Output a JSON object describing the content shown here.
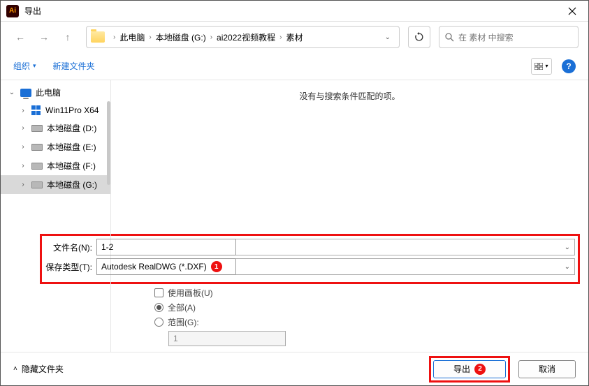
{
  "titlebar": {
    "title": "导出"
  },
  "nav": {
    "breadcrumb": [
      "此电脑",
      "本地磁盘 (G:)",
      "ai2022视频教程",
      "素材"
    ],
    "search_placeholder": "在 素材 中搜索"
  },
  "toolbar": {
    "organize": "组织",
    "new_folder": "新建文件夹"
  },
  "sidebar": {
    "root": "此电脑",
    "items": [
      {
        "label": "Win11Pro X64",
        "icon": "win"
      },
      {
        "label": "本地磁盘 (D:)",
        "icon": "disk"
      },
      {
        "label": "本地磁盘 (E:)",
        "icon": "disk"
      },
      {
        "label": "本地磁盘 (F:)",
        "icon": "disk"
      },
      {
        "label": "本地磁盘 (G:)",
        "icon": "disk",
        "selected": true
      }
    ]
  },
  "main": {
    "empty_text": "没有与搜索条件匹配的项。"
  },
  "form": {
    "filename_label": "文件名(N):",
    "filename_value": "1-2",
    "type_label": "保存类型(T):",
    "type_value": "Autodesk RealDWG (*.DXF)",
    "use_artboard": "使用画板(U)",
    "opt_all": "全部(A)",
    "opt_range": "范围(G):",
    "range_value": "1",
    "badge1": "1"
  },
  "footer": {
    "hide_folders": "隐藏文件夹",
    "export": "导出",
    "cancel": "取消",
    "badge2": "2"
  }
}
